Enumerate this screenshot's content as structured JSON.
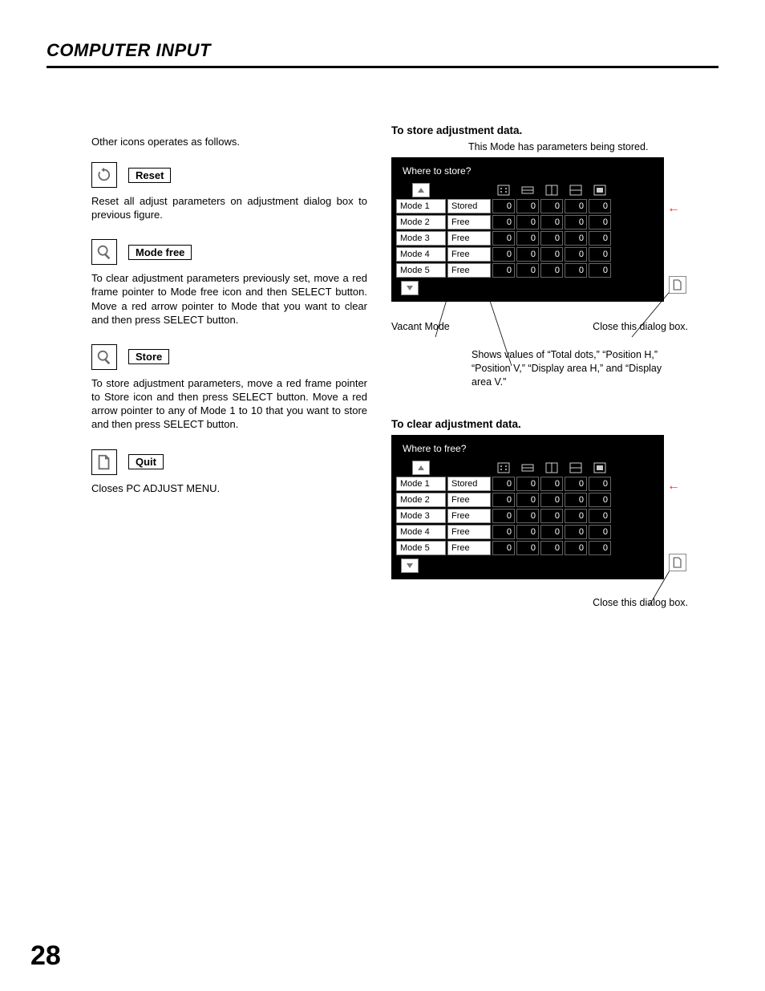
{
  "page": {
    "title": "COMPUTER INPUT",
    "number": "28"
  },
  "left": {
    "intro": "Other icons operates as follows.",
    "reset": {
      "label": "Reset",
      "desc": "Reset all adjust parameters on adjustment dialog box to previous figure."
    },
    "modefree": {
      "label": "Mode free",
      "desc": "To clear adjustment parameters previously set, move a red frame pointer to Mode free icon and then SELECT button.  Move a red arrow pointer to Mode that you want to clear and then press SELECT button."
    },
    "store": {
      "label": "Store",
      "desc": "To store adjustment parameters, move a red frame pointer to Store icon and then press SELECT button.  Move a red arrow pointer to any of Mode 1 to 10 that you want to store and then press SELECT button."
    },
    "quit": {
      "label": "Quit",
      "desc": "Closes PC ADJUST MENU."
    }
  },
  "right": {
    "store_head": "To store adjustment data.",
    "store_callout_top": "This Mode has parameters being stored.",
    "store_dialog": {
      "title": "Where to store?",
      "rows": [
        {
          "mode": "Mode 1",
          "status": "Stored",
          "vals": [
            "0",
            "0",
            "0",
            "0",
            "0"
          ]
        },
        {
          "mode": "Mode 2",
          "status": "Free",
          "vals": [
            "0",
            "0",
            "0",
            "0",
            "0"
          ]
        },
        {
          "mode": "Mode 3",
          "status": "Free",
          "vals": [
            "0",
            "0",
            "0",
            "0",
            "0"
          ]
        },
        {
          "mode": "Mode 4",
          "status": "Free",
          "vals": [
            "0",
            "0",
            "0",
            "0",
            "0"
          ]
        },
        {
          "mode": "Mode 5",
          "status": "Free",
          "vals": [
            "0",
            "0",
            "0",
            "0",
            "0"
          ]
        }
      ]
    },
    "callouts": {
      "vacant": "Vacant Mode",
      "close": "Close this dialog box.",
      "values": "Shows values of “Total dots,” “Position H,” “Position V,” “Display area H,” and “Display area V.”"
    },
    "clear_head": "To clear adjustment data.",
    "clear_dialog": {
      "title": "Where to free?",
      "rows": [
        {
          "mode": "Mode 1",
          "status": "Stored",
          "vals": [
            "0",
            "0",
            "0",
            "0",
            "0"
          ]
        },
        {
          "mode": "Mode 2",
          "status": "Free",
          "vals": [
            "0",
            "0",
            "0",
            "0",
            "0"
          ]
        },
        {
          "mode": "Mode 3",
          "status": "Free",
          "vals": [
            "0",
            "0",
            "0",
            "0",
            "0"
          ]
        },
        {
          "mode": "Mode 4",
          "status": "Free",
          "vals": [
            "0",
            "0",
            "0",
            "0",
            "0"
          ]
        },
        {
          "mode": "Mode 5",
          "status": "Free",
          "vals": [
            "0",
            "0",
            "0",
            "0",
            "0"
          ]
        }
      ]
    },
    "close2": "Close this dialog box."
  }
}
